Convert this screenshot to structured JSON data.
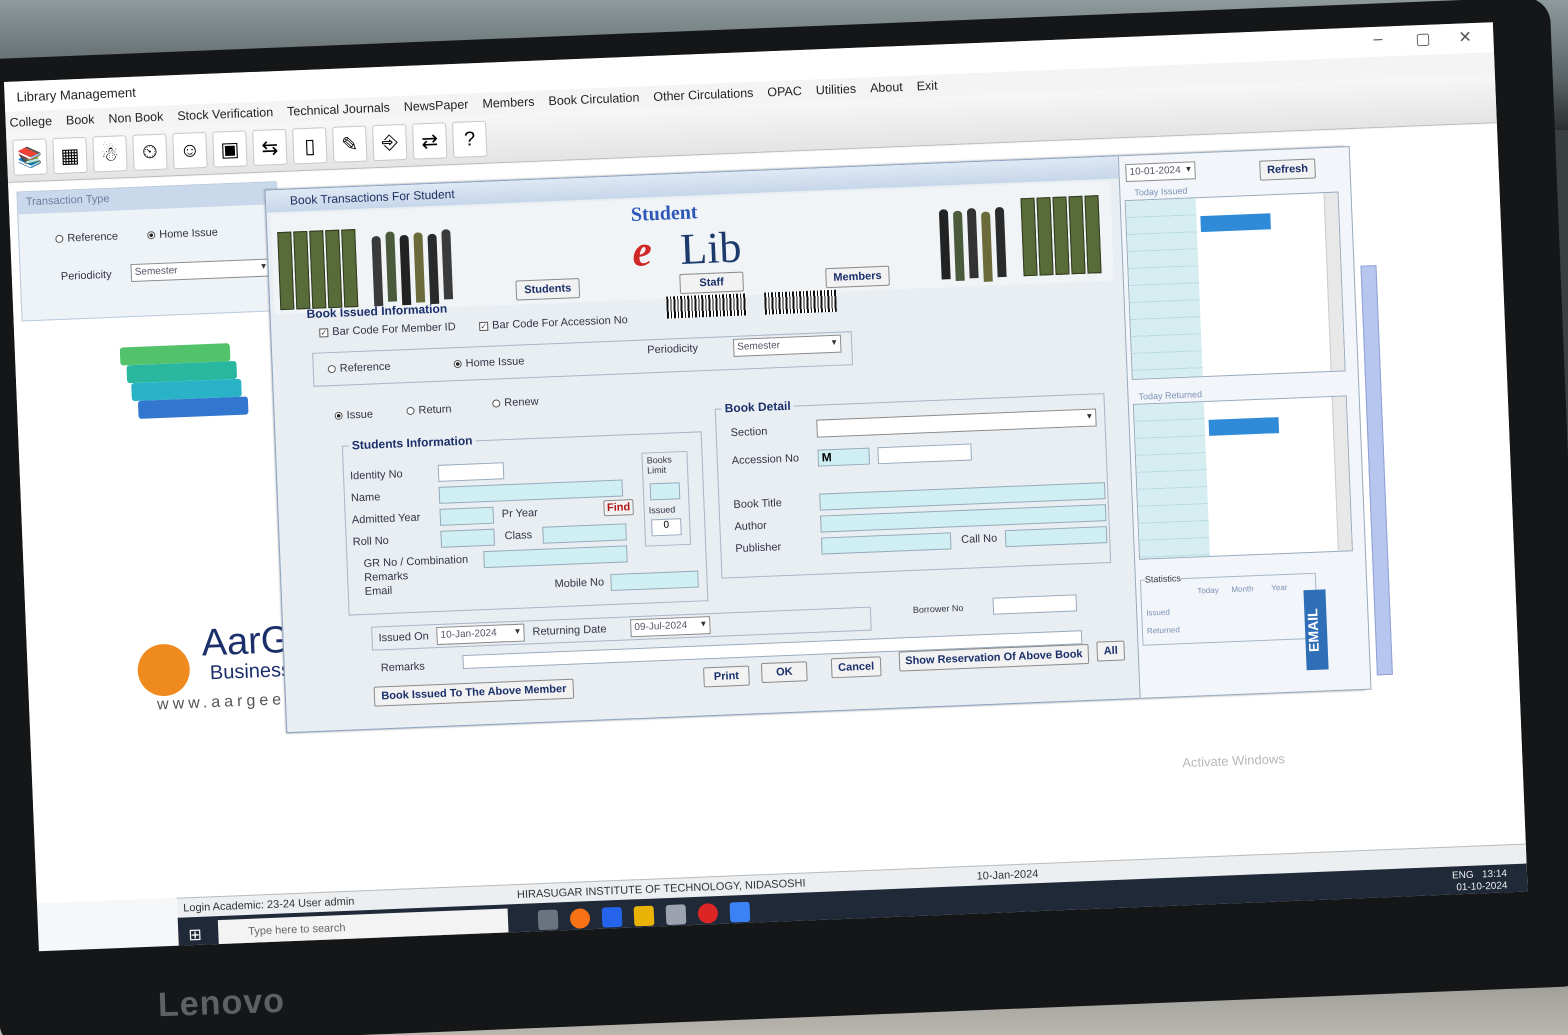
{
  "window": {
    "title": "Library Management"
  },
  "menu": [
    "College",
    "Book",
    "Non Book",
    "Stock Verification",
    "Technical Journals",
    "NewsPaper",
    "Members",
    "Book Circulation",
    "Other Circulations",
    "OPAC",
    "Utilities",
    "About",
    "Exit"
  ],
  "side_panel": {
    "title": "Transaction Type",
    "reference": "Reference",
    "home_issue": "Home Issue",
    "periodicity_label": "Periodicity",
    "periodicity_value": "Semester"
  },
  "logo": {
    "name": "AarGe",
    "tagline": "Business Solut",
    "web": "www.aargees.c"
  },
  "dialog": {
    "title": "Book Transactions For Student",
    "brand_top": "Student",
    "brand_e": "e",
    "brand_lib": "Lib",
    "tab_students": "Students",
    "tab_staff": "Staff",
    "tab_members": "Members",
    "section_issued": "Book Issued Information",
    "chk_member": "Bar Code For Member ID",
    "chk_accession": "Bar Code For Accession No",
    "reference": "Reference",
    "home_issue": "Home Issue",
    "periodicity_label": "Periodicity",
    "periodicity_value": "Semester",
    "issue": "Issue",
    "return": "Return",
    "renew": "Renew"
  },
  "students": {
    "legend": "Students Information",
    "identity_no": "Identity No",
    "name": "Name",
    "admitted_year": "Admitted Year",
    "pr_year": "Pr Year",
    "find": "Find",
    "roll_no": "Roll No",
    "class": "Class",
    "gr_no": "GR No / Combination",
    "remarks": "Remarks",
    "email": "Email",
    "mobile_no": "Mobile No",
    "books_limit": "Books Limit",
    "issued": "Issued",
    "issued_value": "0"
  },
  "book_detail": {
    "legend": "Book Detail",
    "section": "Section",
    "accession_no": "Accession No",
    "accession_value": "M",
    "book_title": "Book Title",
    "author": "Author",
    "publisher": "Publisher",
    "call_no": "Call No"
  },
  "dates": {
    "issued_on": "Issued On",
    "issued_on_value": "10-Jan-2024",
    "returning_date": "Returning Date",
    "returning_value": "09-Jul-2024",
    "borrower_no": "Borrower No",
    "remarks": "Remarks"
  },
  "buttons": {
    "book_issued": "Book Issued To The Above Member",
    "print": "Print",
    "ok": "OK",
    "cancel": "Cancel",
    "show_reservation": "Show Reservation Of Above Book",
    "all": "All"
  },
  "right_panel": {
    "date": "10-01-2024",
    "refresh": "Refresh",
    "today_issued": "Today Issued",
    "today_returned": "Today Returned",
    "statistics": "Statistics",
    "today": "Today",
    "month": "Month",
    "year": "Year",
    "issued": "Issued",
    "returned": "Returned",
    "email": "EMAIL"
  },
  "status": {
    "login": "Login Academic: 23-24  User admin",
    "institute": "HIRASUGAR INSTITUTE OF TECHNOLOGY, NIDASOSHI",
    "date": "10-Jan-2024"
  },
  "taskbar": {
    "search_placeholder": "Type here to search",
    "lang": "ENG",
    "time": "13:14",
    "date": "01-10-2024"
  },
  "activate": "Activate Windows",
  "monitor_brand": "Lenovo",
  "colors": {
    "accent": "#2f8ad8",
    "field": "#cfeff3",
    "title_bar": "#c6d6ea"
  }
}
